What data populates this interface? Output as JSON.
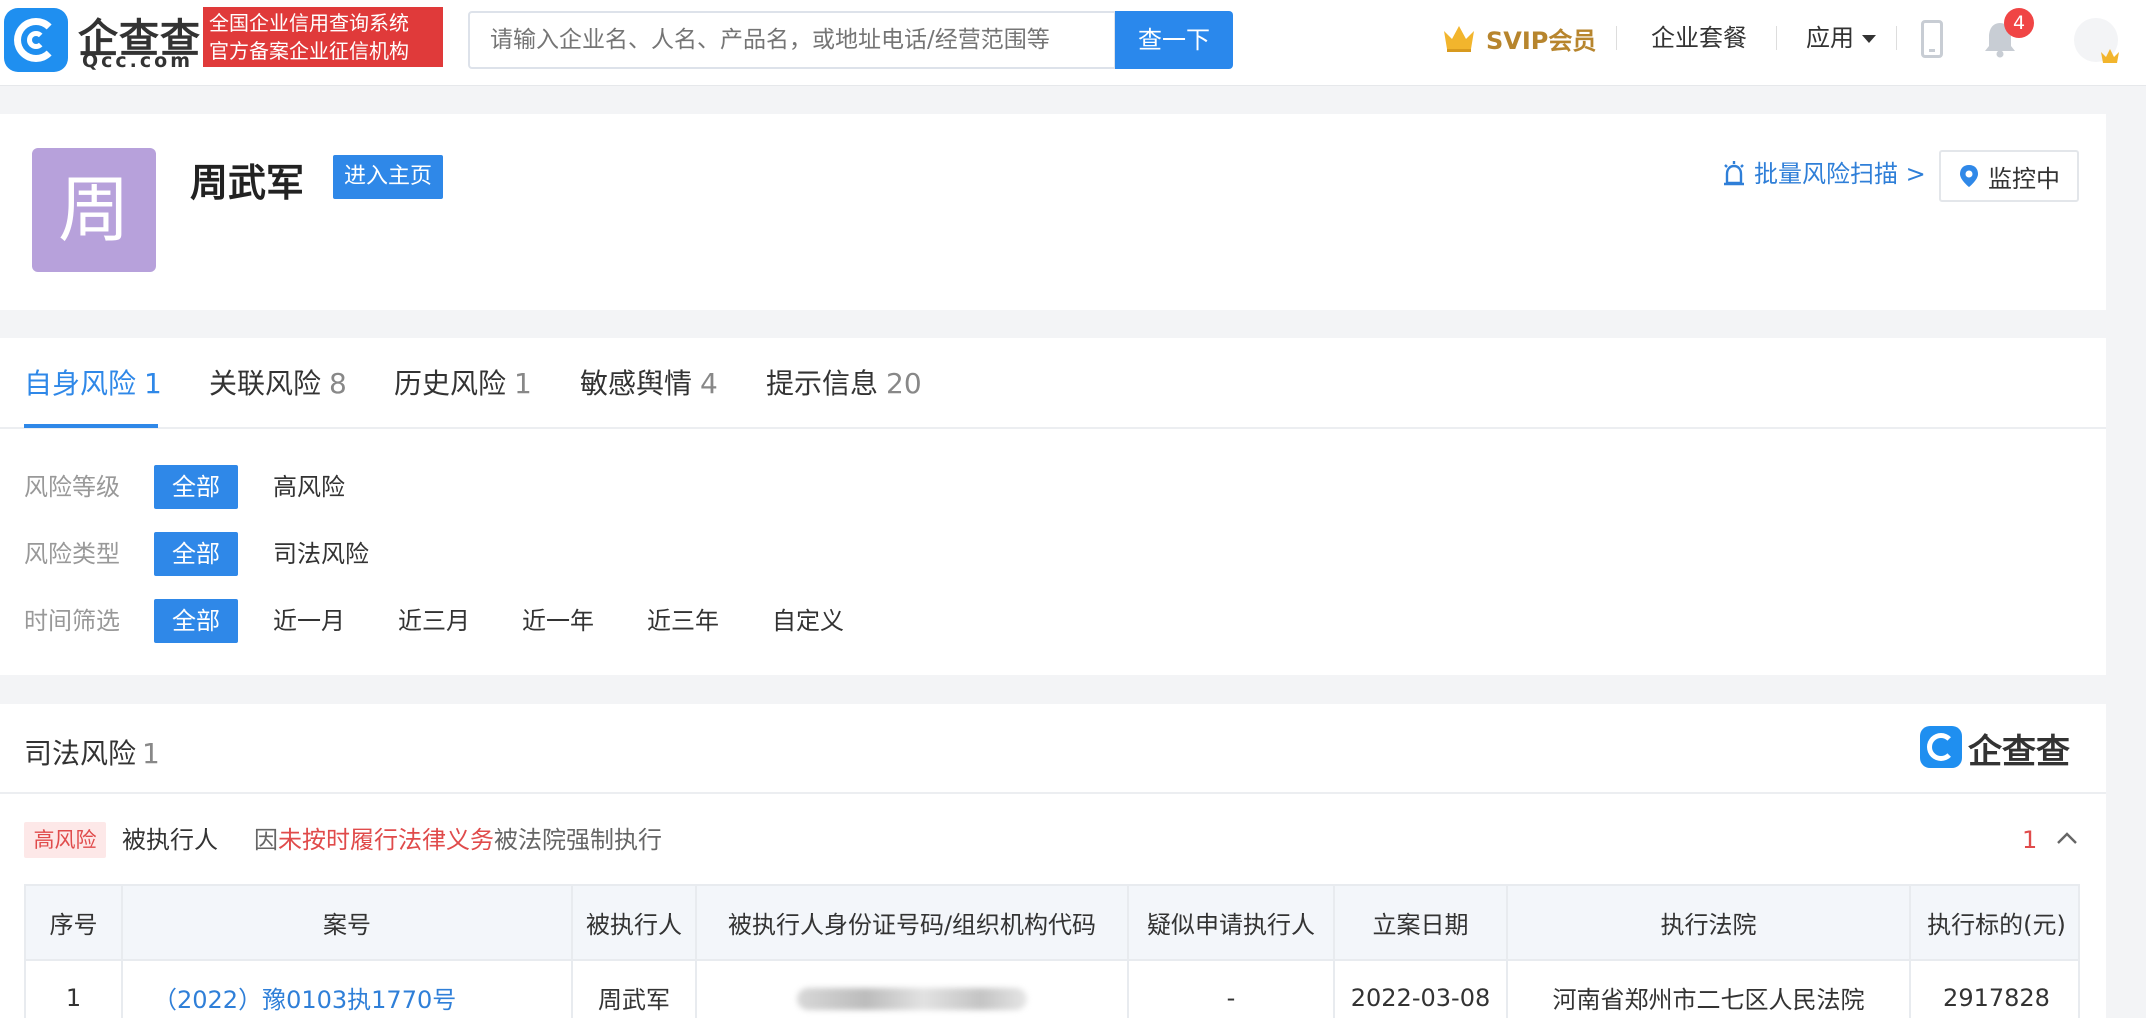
{
  "header": {
    "logo_text": "企查查",
    "logo_domain": "Qcc.com",
    "slogan_line1": "全国企业信用查询系统",
    "slogan_line2": "官方备案企业征信机构",
    "search_placeholder": "请输入企业名、人名、产品名，或地址电话/经营范围等",
    "search_button": "查一下",
    "svip_label": "SVIP会员",
    "enterprise_plan": "企业套餐",
    "apps_label": "应用",
    "notification_count": "4",
    "colors": {
      "brand_blue": "#1f8ff0",
      "search_blue": "#2a88ec",
      "slogan_red": "#e03a3a",
      "svip_gold": "#b7852d"
    }
  },
  "profile": {
    "avatar_char": "周",
    "name": "周武军",
    "home_button": "进入主页",
    "scan_link": "批量风险扫描 >",
    "monitor_button": "监控中",
    "avatar_color": "#b7a1db"
  },
  "tabs": [
    {
      "label": "自身风险",
      "count": "1"
    },
    {
      "label": "关联风险",
      "count": "8"
    },
    {
      "label": "历史风险",
      "count": "1"
    },
    {
      "label": "敏感舆情",
      "count": "4"
    },
    {
      "label": "提示信息",
      "count": "20"
    }
  ],
  "filters": {
    "risk_level": {
      "label": "风险等级",
      "options": [
        "全部",
        "高风险"
      ]
    },
    "risk_type": {
      "label": "风险类型",
      "options": [
        "全部",
        "司法风险"
      ]
    },
    "time": {
      "label": "时间筛选",
      "options": [
        "全部",
        "近一月",
        "近三月",
        "近一年",
        "近三年",
        "自定义"
      ]
    }
  },
  "judicial": {
    "title": "司法风险",
    "count": "1",
    "brand": "企查查",
    "item": {
      "tag": "高风险",
      "type": "被执行人",
      "desc_prefix": "因",
      "desc_highlight": "未按时履行法律义务",
      "desc_suffix": "被法院强制执行",
      "count": "1"
    },
    "table": {
      "headers": [
        "序号",
        "案号",
        "被执行人",
        "被执行人身份证号码/组织机构代码",
        "疑似申请执行人",
        "立案日期",
        "执行法院",
        "执行标的(元)"
      ],
      "rows": [
        {
          "index": "1",
          "case_no": "（2022）豫0103执1770号",
          "executee": "周武军",
          "id_code": "",
          "applicant": "-",
          "date": "2022-03-08",
          "court": "河南省郑州市二七区人民法院",
          "amount": "2917828"
        }
      ]
    }
  }
}
